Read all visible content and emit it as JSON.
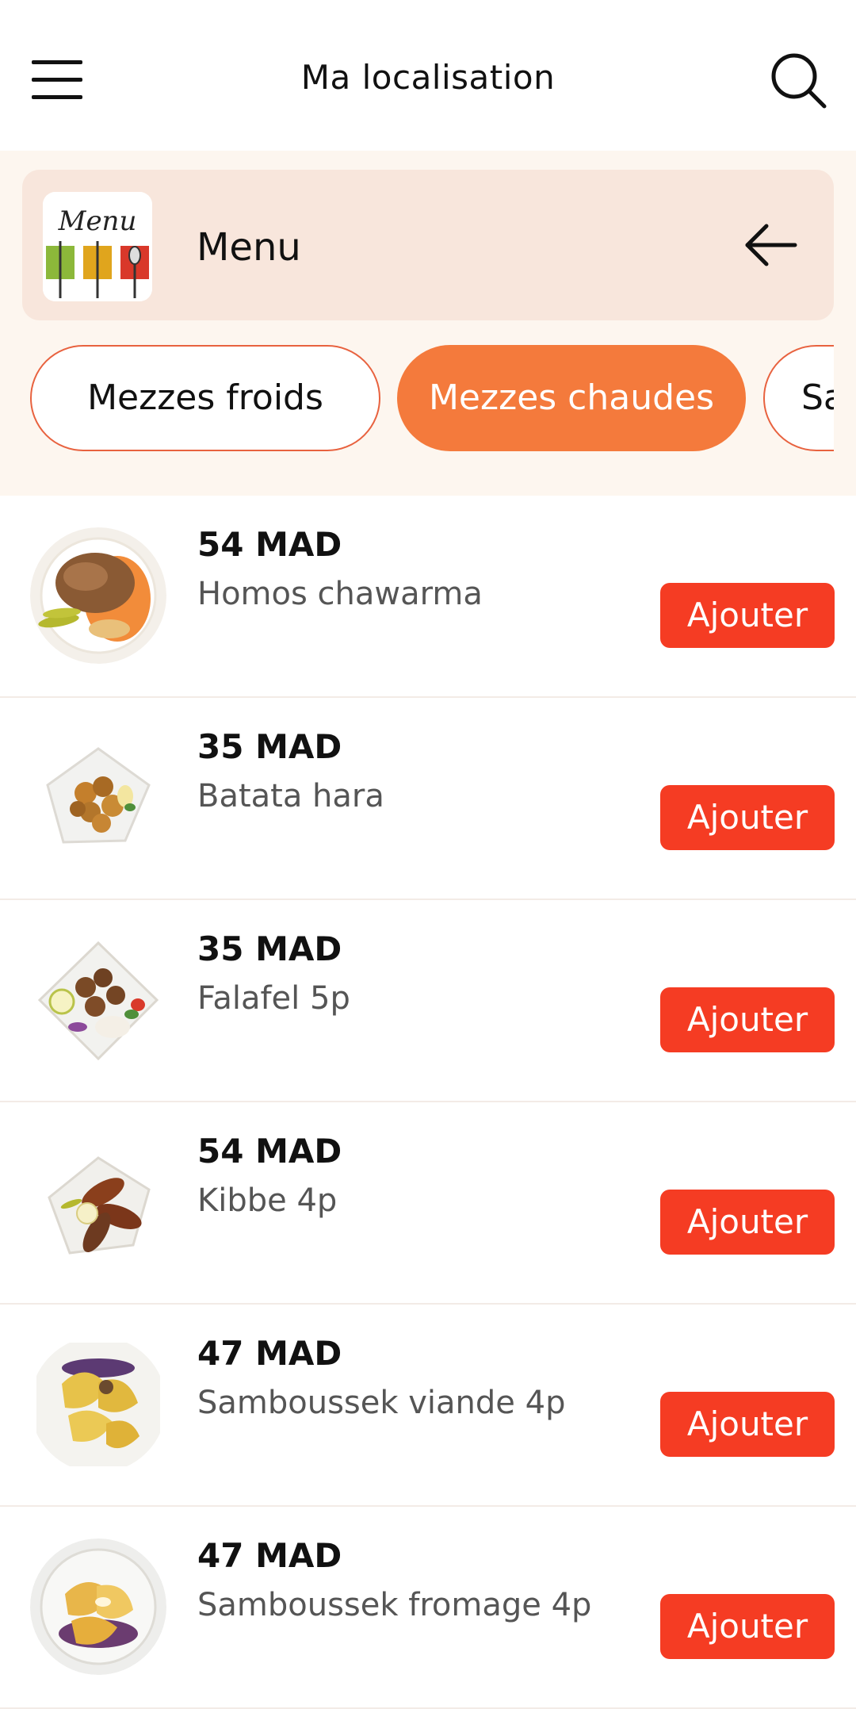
{
  "header": {
    "title": "Ma localisation",
    "menu_icon": "hamburger-icon",
    "search_icon": "search-icon"
  },
  "menu_card": {
    "label": "Menu",
    "logo_icon": "restaurant-menu-logo",
    "back_icon": "arrow-left-icon"
  },
  "categories": [
    {
      "label": "Mezzes froids",
      "active": false
    },
    {
      "label": "Mezzes chaudes",
      "active": true
    },
    {
      "label": "Sa",
      "active": false
    }
  ],
  "products": [
    {
      "price": "54 MAD",
      "name": "Homos chawarma",
      "button": "Ajouter"
    },
    {
      "price": "35 MAD",
      "name": "Batata hara",
      "button": "Ajouter"
    },
    {
      "price": "35 MAD",
      "name": "Falafel 5p",
      "button": "Ajouter"
    },
    {
      "price": "54 MAD",
      "name": "Kibbe 4p",
      "button": "Ajouter"
    },
    {
      "price": "47 MAD",
      "name": "Samboussek viande 4p",
      "button": "Ajouter"
    },
    {
      "price": "47 MAD",
      "name": "Samboussek fromage 4p",
      "button": "Ajouter"
    }
  ],
  "colors": {
    "accent": "#f47a3c",
    "button": "#f53c23",
    "panel": "#fdf6ef",
    "card": "#f8e6dc"
  }
}
